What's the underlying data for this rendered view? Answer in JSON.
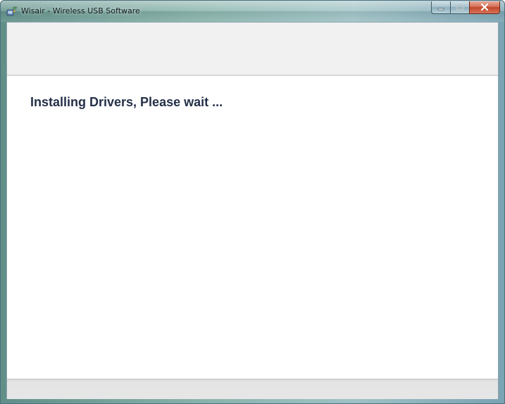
{
  "window": {
    "title": "Wisair - Wireless USB Software",
    "icon": "wisair-app-icon"
  },
  "caption_buttons": {
    "minimize_icon": "minimize-icon",
    "maximize_icon": "maximize-icon",
    "close_icon": "close-icon"
  },
  "content": {
    "status_text": "Installing Drivers, Please wait ..."
  },
  "colors": {
    "heading": "#253048",
    "close_button": "#c0472b",
    "frame": "#88b3ab"
  }
}
